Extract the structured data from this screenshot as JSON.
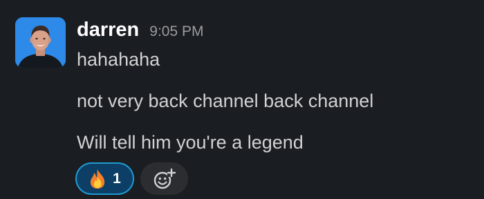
{
  "message": {
    "sender": "darren",
    "timestamp": "9:05 PM",
    "lines": [
      "hahahaha",
      "not very back channel back channel",
      "Will tell him you're a legend"
    ]
  },
  "reactions": [
    {
      "emoji": "fire-icon",
      "count": "1",
      "selected": true
    }
  ],
  "add_reaction": {
    "icon": "add-emoji-icon"
  },
  "colors": {
    "background": "#1a1d21",
    "reaction_selected_bg": "#0d3f66",
    "reaction_selected_border": "#1d9bd1",
    "avatar_bg": "#2d8ae8"
  }
}
